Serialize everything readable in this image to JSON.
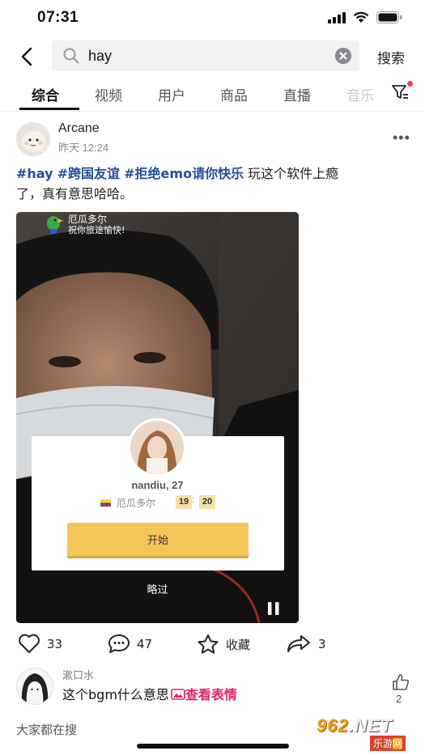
{
  "status_bar": {
    "time": "07:31"
  },
  "search": {
    "query": "hay",
    "button_label": "搜索"
  },
  "tabs": [
    {
      "label": "综合",
      "active": true
    },
    {
      "label": "视频"
    },
    {
      "label": "用户"
    },
    {
      "label": "商品"
    },
    {
      "label": "直播"
    },
    {
      "label": "音乐"
    }
  ],
  "post": {
    "author": "Arcane",
    "time": "昨天 12:24",
    "tags": [
      "#hay",
      "#跨国友谊",
      "#拒绝emo请你快乐"
    ],
    "text_line1_rest": "玩这个软件上瘾",
    "text_line2": "了，真有意思哈哈。",
    "video": {
      "overlay_title": "厄瓜多尔",
      "overlay_subtitle": "祝你旅途愉快!",
      "match_name": "nandiu, 27",
      "match_country": "厄瓜多尔",
      "timer_minutes": "19",
      "timer_seconds": "20",
      "start_label": "开始",
      "skip_label": "略过"
    },
    "actions": {
      "shares": "33",
      "comments": "47",
      "save_label": "收藏",
      "forward_count": "3"
    }
  },
  "comment": {
    "user": "漱口水",
    "text": "这个bgm什么意思",
    "link_label": "查看表情",
    "likes": "2"
  },
  "trending_label": "大家都在搜",
  "watermark": {
    "brand_num": "962",
    "brand_net": ".NET",
    "site_a": "乐游",
    "site_b": "网"
  },
  "colors": {
    "accent_tag": "#1f4e99",
    "link": "#e0245e",
    "button_yellow": "#f4c659",
    "badge_red": "#ff3b4a"
  }
}
